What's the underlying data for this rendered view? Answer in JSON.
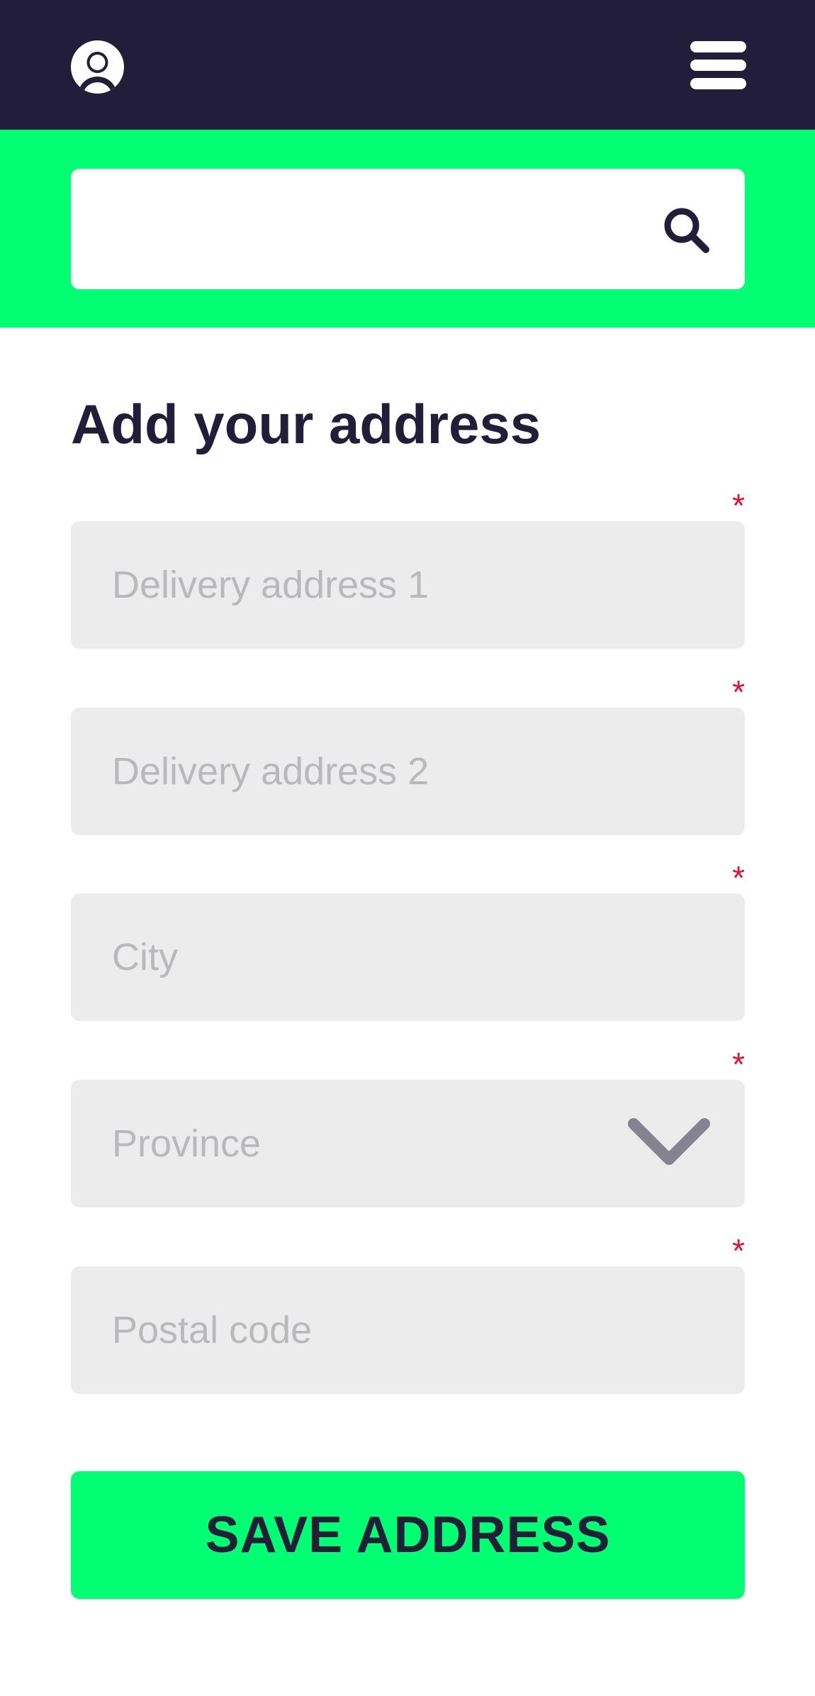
{
  "header": {
    "avatar_icon": "user-avatar-icon",
    "menu_icon": "hamburger-menu-icon",
    "background_color": "#221e3a"
  },
  "search": {
    "value": "",
    "placeholder": "",
    "icon": "search-icon",
    "band_color": "#00ff73"
  },
  "form": {
    "title": "Add your address",
    "required_marker": "*",
    "fields": [
      {
        "placeholder": "Delivery address 1",
        "value": "",
        "required": true
      },
      {
        "placeholder": "Delivery address 2",
        "value": "",
        "required": true
      },
      {
        "placeholder": "City",
        "value": "",
        "required": true
      },
      {
        "placeholder": "Province",
        "value": "",
        "required": true,
        "type": "select"
      },
      {
        "placeholder": "Postal code",
        "value": "",
        "required": true
      }
    ],
    "save_label": "SAVE ADDRESS"
  },
  "colors": {
    "accent": "#00ff73",
    "dark": "#221e3a",
    "required": "#e8102e",
    "field_bg": "#ececec",
    "placeholder": "#b9b9bd"
  }
}
